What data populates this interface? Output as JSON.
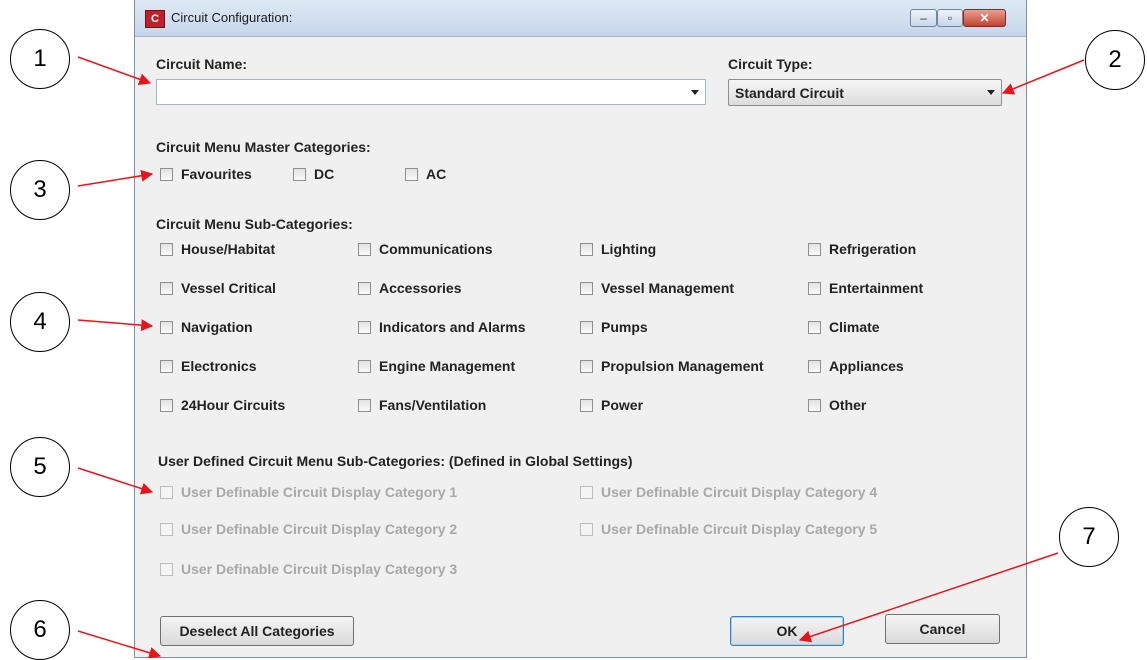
{
  "window": {
    "title": "Circuit Configuration:",
    "controls": [
      "–",
      "▫",
      "✕"
    ]
  },
  "circuit_name": {
    "label": "Circuit Name:",
    "value": ""
  },
  "circuit_type": {
    "label": "Circuit Type:",
    "value": "Standard Circuit"
  },
  "master": {
    "heading": "Circuit Menu Master Categories:",
    "items": [
      "Favourites",
      "DC",
      "AC"
    ]
  },
  "sub": {
    "heading": "Circuit Menu Sub-Categories:",
    "columns": [
      [
        "House/Habitat",
        "Vessel Critical",
        "Navigation",
        "Electronics",
        "24Hour Circuits"
      ],
      [
        "Communications",
        "Accessories",
        "Indicators and Alarms",
        "Engine Management",
        "Fans/Ventilation"
      ],
      [
        "Lighting",
        "Vessel Management",
        "Pumps",
        "Propulsion Management",
        "Power"
      ],
      [
        "Refrigeration",
        "Entertainment",
        "Climate",
        "Appliances",
        "Other"
      ]
    ]
  },
  "user_defined": {
    "heading": "User Defined Circuit Menu Sub-Categories: (Defined in Global Settings)",
    "items": [
      "User Definable Circuit Display Category 1",
      "User Definable Circuit Display Category 2",
      "User Definable Circuit Display Category 3",
      "User Definable Circuit Display Category 4",
      "User Definable Circuit Display Category 5"
    ]
  },
  "buttons": {
    "deselect": "Deselect All Categories",
    "ok": "OK",
    "cancel": "Cancel"
  },
  "callouts": [
    "1",
    "2",
    "3",
    "4",
    "5",
    "6",
    "7"
  ],
  "colors": {
    "arrow": "#e8141a",
    "title_bar": "#c6d6ea"
  }
}
